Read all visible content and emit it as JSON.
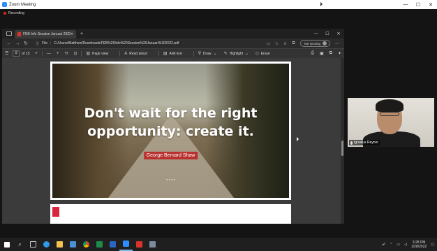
{
  "zoom": {
    "window_title": "Zoom Meeting",
    "recording_label": "Recording",
    "controls": [
      "—",
      "☐",
      "✕"
    ]
  },
  "edge": {
    "tab_title": "FEB Info Session Januari 2022.pdf",
    "new_tab": "+",
    "window_controls": [
      "—",
      "☐",
      "✕"
    ],
    "address": {
      "file_label": "File",
      "url": "C:/Users/Matthew/Downloads/FEB%20Info%20Session%20Januari%202022.pdf",
      "sync_label": "Not syncing"
    },
    "pdf_toolbar": {
      "page_current": "8",
      "page_total": "of 15",
      "minus": "—",
      "plus": "+",
      "page_view": "Page view",
      "read_aloud": "Read aloud",
      "add_text": "Add text",
      "draw": "Draw",
      "highlight": "Highlight",
      "erase": "Erase"
    }
  },
  "slide": {
    "quote_line1": "Don't wait for the right",
    "quote_line2": "opportunity: create it.",
    "author": "George Bernard Shaw",
    "dots": "● ● ● ●"
  },
  "participant": {
    "name": "Ignatius Reyner"
  },
  "taskbar": {
    "time": "3:28 PM",
    "date": "1/28/2022",
    "apps": [
      {
        "name": "start",
        "color": "#ffffff"
      },
      {
        "name": "search",
        "color": "#dddddd"
      },
      {
        "name": "task-view",
        "color": "#cccccc"
      },
      {
        "name": "edge",
        "color": "#2f9be8"
      },
      {
        "name": "file-explorer",
        "color": "#f2c14e"
      },
      {
        "name": "store",
        "color": "#4a90d9"
      },
      {
        "name": "chrome",
        "color": "#e3b33a"
      },
      {
        "name": "excel",
        "color": "#1d8c4a"
      },
      {
        "name": "word",
        "color": "#2b65c3"
      },
      {
        "name": "zoom",
        "color": "#2d8cff"
      },
      {
        "name": "acrobat",
        "color": "#d9342b"
      },
      {
        "name": "photos",
        "color": "#7b8b9d"
      }
    ]
  }
}
